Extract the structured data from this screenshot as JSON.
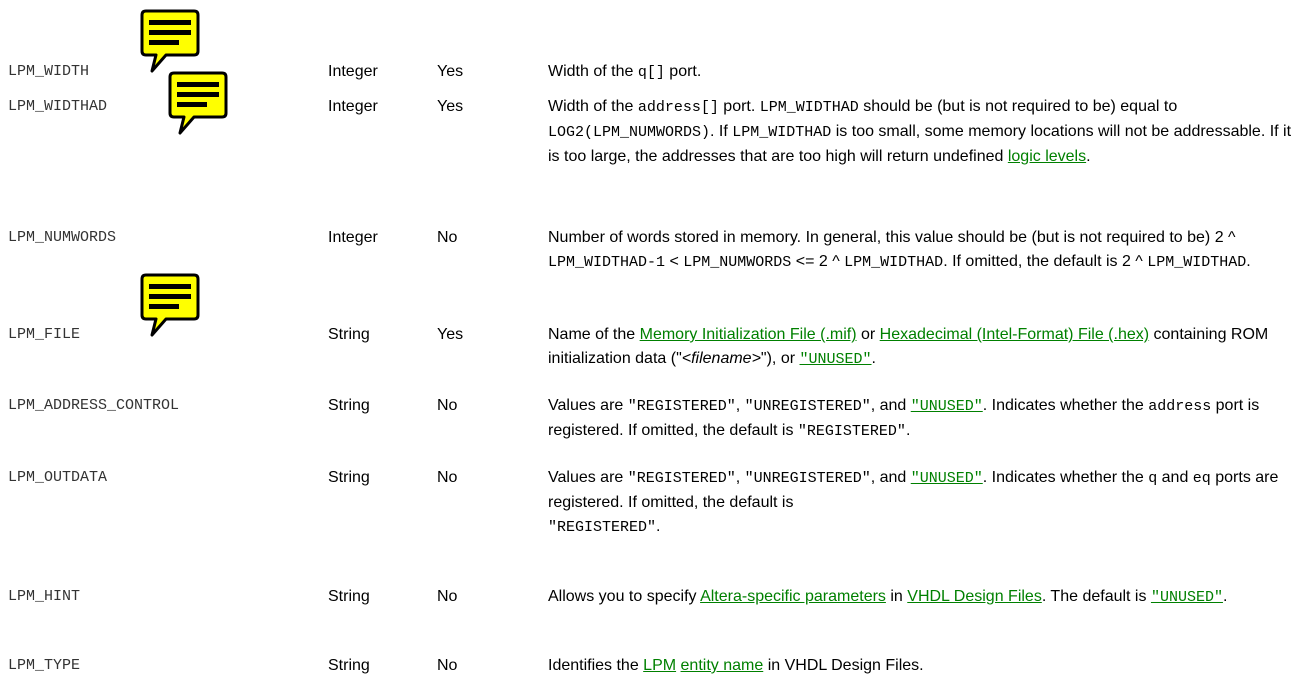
{
  "rows": [
    {
      "name": "LPM_WIDTH",
      "type": "Integer",
      "required": "Yes",
      "desc": {
        "t1": "Width of the ",
        "c1": "q[]",
        "t2": " port."
      }
    },
    {
      "name": "LPM_WIDTHAD",
      "type": "Integer",
      "required": "Yes",
      "desc": {
        "t1": "Width of the ",
        "c1": "address[]",
        "t2": " port. ",
        "c2": "LPM_WIDTHAD",
        "t3": " should be (but is not required to be) equal to ",
        "c3": "LOG2(LPM_NUMWORDS)",
        "t4": ". If ",
        "c4": "LPM_WIDTHAD",
        "t5": " is too small, some memory locations will not be addressable. If it is too large, the addresses that are too high will return undefined ",
        "link1": "logic levels",
        "t6": "."
      }
    },
    {
      "name": "LPM_NUMWORDS",
      "type": "Integer",
      "required": "No",
      "desc": {
        "t1": "Number of words stored in memory. In general, this value should be (but is not required to be) 2 ^ ",
        "c1": "LPM_WIDTHAD-1",
        "t2": " < ",
        "c2": "LPM_NUMWORDS",
        "t3": " <= 2 ^ ",
        "c3": "LPM_WIDTHAD",
        "t4": ". If omitted, the default is 2 ^ ",
        "c4": "LPM_WIDTHAD",
        "t5": "."
      }
    },
    {
      "name": "LPM_FILE",
      "type": "String",
      "required": "Yes",
      "desc": {
        "t1": "Name of the ",
        "link1": "Memory Initialization File (.mif)",
        "t2": " or ",
        "link2": "Hexadecimal (Intel-Format) File (.hex)",
        "t3": " containing ROM initialization data (\"",
        "i1": "<filename>",
        "t4": "\"), or ",
        "link3": "\"UNUSED\"",
        "t5": "."
      }
    },
    {
      "name": "LPM_ADDRESS_CONTROL",
      "type": "String",
      "required": "No",
      "desc": {
        "t1": "Values are ",
        "c1": "\"REGISTERED\"",
        "t2": ", ",
        "c2": "\"UNREGISTERED\"",
        "t3": ", and ",
        "link1": "\"UNUSED\"",
        "t4": ". Indicates whether the ",
        "c3": "address",
        "t5": " port is registered. If omitted, the default is ",
        "c4": "\"REGISTERED\"",
        "t6": "."
      }
    },
    {
      "name": "LPM_OUTDATA",
      "type": "String",
      "required": "No",
      "desc": {
        "t1": "Values are ",
        "c1": "\"REGISTERED\"",
        "t2": ", ",
        "c2": "\"UNREGISTERED\"",
        "t3": ", and ",
        "link1": "\"UNUSED\"",
        "t4": ". Indicates whether the ",
        "c3": "q",
        "t5": " and ",
        "c4": "eq",
        "t6": " ports are registered. If omitted, the default is ",
        "c5": "\"REGISTERED\"",
        "t7": "."
      }
    },
    {
      "name": "LPM_HINT",
      "type": "String",
      "required": "No",
      "desc": {
        "t1": "Allows you to specify ",
        "link1": "Altera-specific parameters",
        "t2": " in ",
        "link2": "VHDL Design Files",
        "t3": ". The default is ",
        "link3": "\"UNUSED\"",
        "t4": "."
      }
    },
    {
      "name": "LPM_TYPE",
      "type": "String",
      "required": "No",
      "desc": {
        "t1": "Identifies the ",
        "link1": "LPM",
        "t2": " ",
        "link2": "entity name",
        "t3": " in VHDL Design Files."
      }
    }
  ],
  "note_icon": {
    "name": "comment-note-icon",
    "fill": "#ffff00",
    "stroke": "#000000"
  }
}
